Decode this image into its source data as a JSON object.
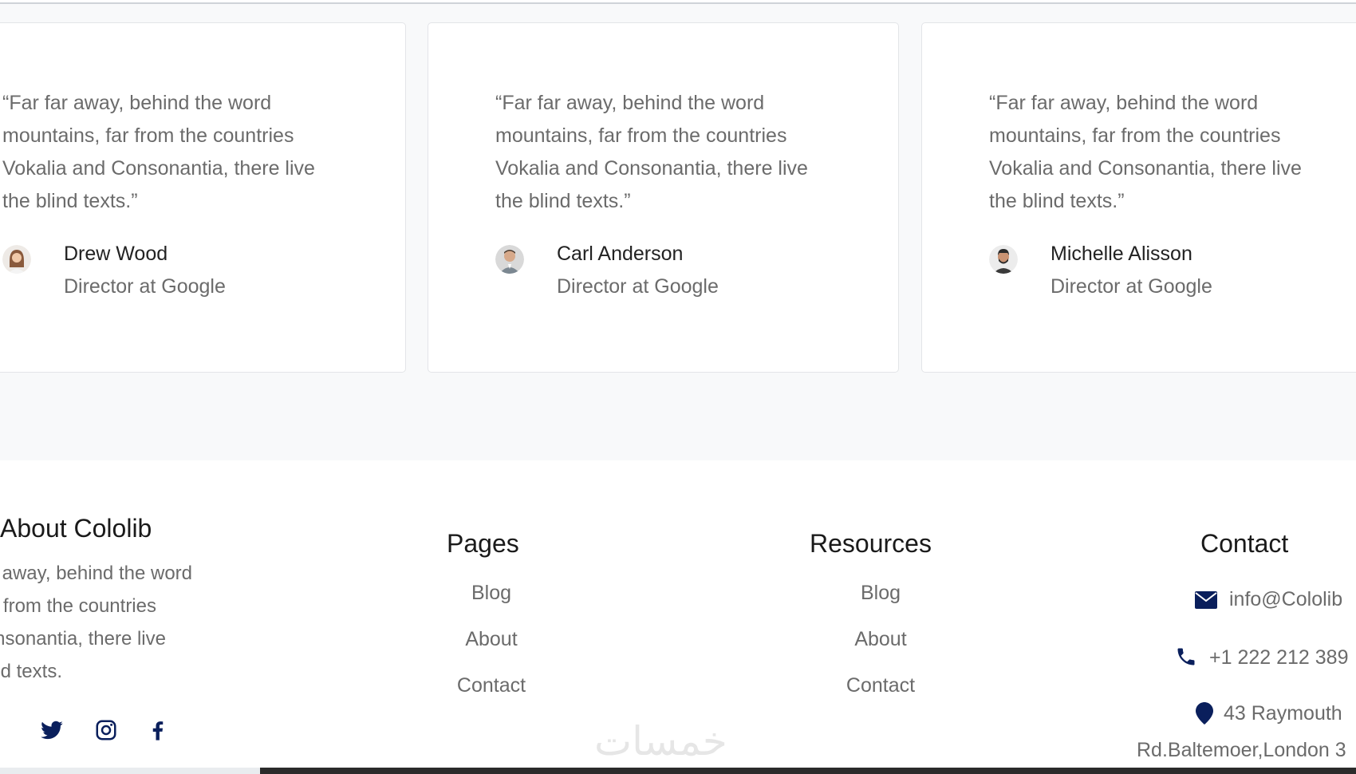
{
  "testimonials": [
    {
      "quote": "“Far far away, behind the word mountains, far from the countries Vokalia and Consonantia, there live the blind texts.”",
      "name": "Drew Wood",
      "role": "Director at Google"
    },
    {
      "quote": "“Far far away, behind the word mountains, far from the countries Vokalia and Consonantia, there live the blind texts.”",
      "name": "Carl Anderson",
      "role": "Director at Google"
    },
    {
      "quote": "“Far far away, behind the word mountains, far from the countries Vokalia and Consonantia, there live the blind texts.”",
      "name": "Michelle Alisson",
      "role": "Director at Google"
    }
  ],
  "footer": {
    "about": {
      "title": "About Cololib",
      "text_lines": [
        "r away, behind the word",
        "ns, far from the countries",
        "nd Consonantia, there live",
        "the blind texts."
      ]
    },
    "social_icons": [
      "twitter-icon",
      "instagram-icon",
      "facebook-icon"
    ],
    "pages": {
      "title": "Pages",
      "links": [
        "Blog",
        "About",
        "Contact"
      ]
    },
    "resources": {
      "title": "Resources",
      "links": [
        "Blog",
        "About",
        "Contact"
      ]
    },
    "contact": {
      "title": "Contact",
      "email": "info@Cololib",
      "phone": "+1 222 212 389",
      "address_line1": "43 Raymouth",
      "address_line2": "Rd.Baltemoer,London 3"
    }
  },
  "watermark": "خمسات",
  "colors": {
    "accent": "#0a1f5c",
    "text": "#6b6b6b",
    "section_bg": "#f8f9fa"
  }
}
